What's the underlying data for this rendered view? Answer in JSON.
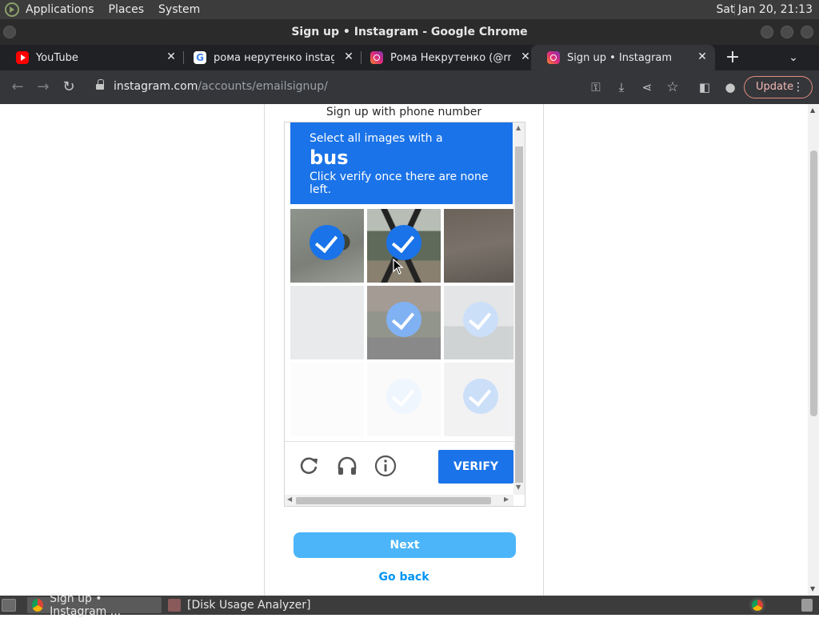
{
  "top_panel": {
    "menus": [
      "Applications",
      "Places",
      "System"
    ],
    "clock": "Sat Jan 20, 21:13"
  },
  "window": {
    "title": "Sign up • Instagram - Google Chrome"
  },
  "tabs": [
    {
      "label": "YouTube",
      "favicon": "youtube-icon"
    },
    {
      "label": "рома нерутенко instagram",
      "favicon": "google-icon"
    },
    {
      "label": "Рома Некрутенко (@rnekr",
      "favicon": "instagram-icon"
    },
    {
      "label": "Sign up • Instagram",
      "favicon": "instagram-icon",
      "active": true
    }
  ],
  "toolbar": {
    "url_host": "instagram.com",
    "url_path": "/accounts/emailsignup/",
    "update_label": "Update",
    "menu_glyph": "⋮"
  },
  "page": {
    "phone_signup": "Sign up with phone number",
    "next_label": "Next",
    "go_back_label": "Go back"
  },
  "captcha": {
    "instruction_line1": "Select all images with a",
    "target_object": "bus",
    "instruction_line3": "Click verify once there are none left.",
    "verify_label": "VERIFY",
    "header_color": "#1a73e8",
    "tiles": [
      {
        "checked": true,
        "fade": "none"
      },
      {
        "checked": true,
        "fade": "none"
      },
      {
        "checked": false,
        "fade": "none"
      },
      {
        "checked": false,
        "fade": "fade1"
      },
      {
        "checked": true,
        "fade": "fade1"
      },
      {
        "checked": true,
        "fade": "fade2"
      },
      {
        "checked": false,
        "fade": "fade3"
      },
      {
        "checked": true,
        "fade": "fade3"
      },
      {
        "checked": true,
        "fade": "fade3"
      }
    ]
  },
  "taskbar": {
    "tasks": [
      "Sign up • Instagram ...",
      "[Disk Usage Analyzer]"
    ]
  }
}
